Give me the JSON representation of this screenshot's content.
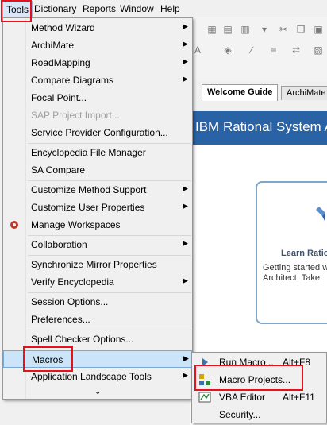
{
  "menubar": {
    "tools": "Tools",
    "dictionary": "Dictionary",
    "reports": "Reports",
    "window": "Window",
    "help": "Help"
  },
  "tabs": {
    "welcome": "Welcome Guide",
    "archimate": "ArchiMate"
  },
  "banner": {
    "title": "IBM Rational System Architect"
  },
  "card": {
    "title": "Learn Rational",
    "lines": [
      "Getting started with",
      "Architect. Take"
    ]
  },
  "tools_menu": {
    "method_wizard": "Method Wizard",
    "archimate": "ArchiMate",
    "roadmapping": "RoadMapping",
    "compare_diagrams": "Compare Diagrams",
    "focal_point": "Focal Point...",
    "sap_project_import": "SAP Project Import...",
    "service_provider_config": "Service Provider Configuration...",
    "encyclopedia_file_manager": "Encyclopedia File Manager",
    "sa_compare": "SA Compare",
    "customize_method_support": "Customize Method Support",
    "customize_user_properties": "Customize User Properties",
    "manage_workspaces": "Manage Workspaces",
    "collaboration": "Collaboration",
    "synchronize_mirror": "Synchronize Mirror Properties",
    "verify_encyclopedia": "Verify Encyclopedia",
    "session_options": "Session Options...",
    "preferences": "Preferences...",
    "spell_checker": "Spell Checker Options...",
    "macros": "Macros",
    "app_landscape_tools": "Application Landscape Tools",
    "more_glyph": "⌄"
  },
  "macros_submenu": {
    "run_macro": "Run Macro...",
    "run_macro_shortcut": "Alt+F8",
    "macro_projects": "Macro Projects...",
    "vba_editor": "VBA Editor",
    "vba_editor_shortcut": "Alt+F11",
    "security": "Security..."
  },
  "colors": {
    "highlight_box": "#e8101a",
    "menu_highlight": "#cce4f7",
    "banner": "#2a62a6"
  }
}
